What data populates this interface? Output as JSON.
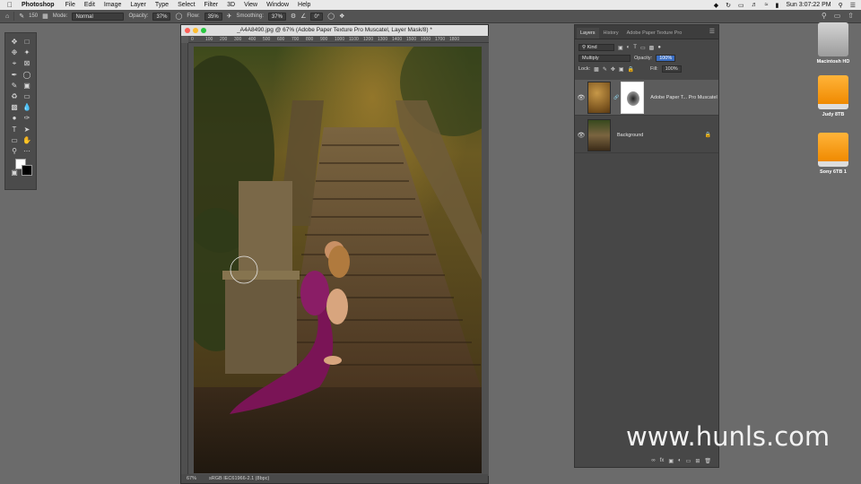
{
  "menubar": {
    "app_name": "Photoshop",
    "items": [
      "File",
      "Edit",
      "Image",
      "Layer",
      "Type",
      "Select",
      "Filter",
      "3D",
      "View",
      "Window",
      "Help"
    ],
    "clock": "Sun 3:07:22 PM"
  },
  "options": {
    "brush_size": "150",
    "mode_label": "Mode:",
    "mode_value": "Normal",
    "opacity_label": "Opacity:",
    "opacity_value": "37%",
    "flow_label": "Flow:",
    "flow_value": "35%",
    "smoothing_label": "Smoothing:",
    "smoothing_value": "37%",
    "angle_value": "0°"
  },
  "document": {
    "title": "_A4A8490.jpg @ 67% (Adobe Paper Texture Pro Muscatel, Layer Mask/8) *",
    "ruler_ticks": [
      "0",
      "100",
      "200",
      "300",
      "400",
      "500",
      "600",
      "700",
      "800",
      "900",
      "1000",
      "1100",
      "1200",
      "1300",
      "1400",
      "1500",
      "1600",
      "1700",
      "1800"
    ],
    "zoom": "67%",
    "color_profile": "sRGB IEC61966-2.1 (8bpc)"
  },
  "layers_panel": {
    "tabs": [
      "Layers",
      "History",
      "Adobe Paper Texture Pro"
    ],
    "filter_kind": "Kind",
    "blend_mode": "Multiply",
    "opacity_label": "Opacity:",
    "opacity_value": "100%",
    "lock_label": "Lock:",
    "fill_label": "Fill:",
    "fill_value": "100%",
    "layers": [
      {
        "name": "Adobe Paper T... Pro Muscatel"
      },
      {
        "name": "Background"
      }
    ]
  },
  "desktop": {
    "drives": [
      {
        "label": "Macintosh HD"
      },
      {
        "label": "Judy 8TB"
      },
      {
        "label": "Sony 6TB 1"
      }
    ]
  },
  "watermark": "www.hunls.com",
  "colors": {
    "selection_blue": "#3b6ec2",
    "drive_orange": "#f5a00a"
  }
}
